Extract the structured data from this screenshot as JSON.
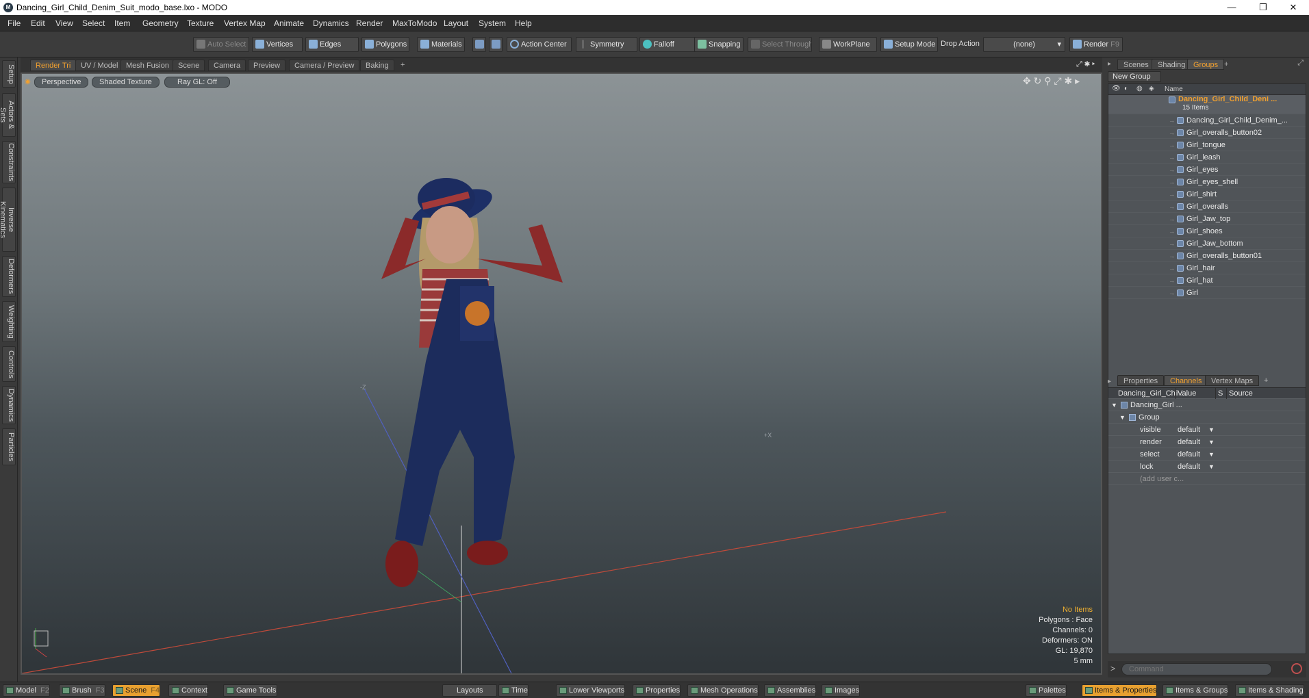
{
  "window": {
    "title": "Dancing_Girl_Child_Denim_Suit_modo_base.lxo - MODO",
    "logo": "M",
    "minimize": "—",
    "restore": "❐",
    "close": "✕"
  },
  "menu": [
    "File",
    "Edit",
    "View",
    "Select",
    "Item",
    "Geometry",
    "Texture",
    "Vertex Map",
    "Animate",
    "Dynamics",
    "Render",
    "MaxToModo",
    "Layout",
    "System",
    "Help"
  ],
  "toolbar": {
    "auto_select": "Auto Select",
    "vertices": "Vertices",
    "edges": "Edges",
    "polygons": "Polygons",
    "materials": "Materials",
    "action_center": "Action Center",
    "symmetry": "Symmetry",
    "falloff": "Falloff",
    "snapping": "Snapping",
    "select_through": "Select Through",
    "workplane": "WorkPlane",
    "setup_mode": "Setup Mode",
    "drop_action_label": "Drop Action",
    "drop_action_value": "(none)",
    "render": "Render",
    "render_key": "F9"
  },
  "left_tabs": [
    "Setup",
    "Actors & Sets",
    "Constraints",
    "Inverse Kinematics",
    "Deformers",
    "Weighting",
    "Controls",
    "Dynamics",
    "Particles"
  ],
  "viewport_tabs": [
    "Render Tri",
    "UV / Model",
    "Mesh Fusion",
    "Scene",
    "Camera",
    "Preview",
    "Camera / Preview",
    "Baking",
    "+"
  ],
  "viewport": {
    "view_mode": "Perspective",
    "shading": "Shaded Texture",
    "raygl": "Ray GL: Off",
    "axis_z": "-Z",
    "axis_x": "+X",
    "stats": {
      "items": "No Items",
      "polygons": "Polygons : Face",
      "channels": "Channels: 0",
      "deformers": "Deformers: ON",
      "gl": "GL: 19,870",
      "size": "5 mm"
    }
  },
  "right_top_tabs": [
    "Scenes",
    "Shading",
    "Groups",
    "+"
  ],
  "groups": {
    "new_group": "New Group",
    "col_name": "Name",
    "root": "Dancing_Girl_Child_Deni ...",
    "root_count": "15 Items",
    "items": [
      "Dancing_Girl_Child_Denim_...",
      "Girl_overalls_button02",
      "Girl_tongue",
      "Girl_leash",
      "Girl_eyes",
      "Girl_eyes_shell",
      "Girl_shirt",
      "Girl_overalls",
      "Girl_Jaw_top",
      "Girl_shoes",
      "Girl_Jaw_bottom",
      "Girl_overalls_button01",
      "Girl_hair",
      "Girl_hat",
      "Girl"
    ]
  },
  "right_bottom_tabs": [
    "Properties",
    "Channels",
    "Vertex Maps",
    "+"
  ],
  "channels": {
    "col_name": "Dancing_Girl_Chil ...",
    "col_value": "Value",
    "col_s": "S",
    "col_source": "Source",
    "item": "Dancing_Girl ...",
    "group": "Group",
    "rows": [
      {
        "name": "visible",
        "value": "default"
      },
      {
        "name": "render",
        "value": "default"
      },
      {
        "name": "select",
        "value": "default"
      },
      {
        "name": "lock",
        "value": "default"
      }
    ],
    "add_user": "(add user c..."
  },
  "command": {
    "placeholder": "Command",
    "prompt": ">"
  },
  "bottom_bar": {
    "model": "Model",
    "model_key": "F2",
    "brush": "Brush",
    "brush_key": "F3",
    "scene": "Scene",
    "scene_key": "F4",
    "context": "Context",
    "game_tools": "Game Tools",
    "layouts": "Layouts",
    "time": "Time",
    "lower_viewports": "Lower Viewports",
    "properties": "Properties",
    "mesh_operations": "Mesh Operations",
    "assemblies": "Assemblies",
    "images": "Images",
    "palettes": "Palettes",
    "items_properties": "Items & Properties",
    "items_groups": "Items & Groups",
    "items_shading": "Items & Shading"
  },
  "colors": {
    "accent": "#f0a030",
    "bg": "#3a3a3a",
    "panel": "#505458"
  }
}
